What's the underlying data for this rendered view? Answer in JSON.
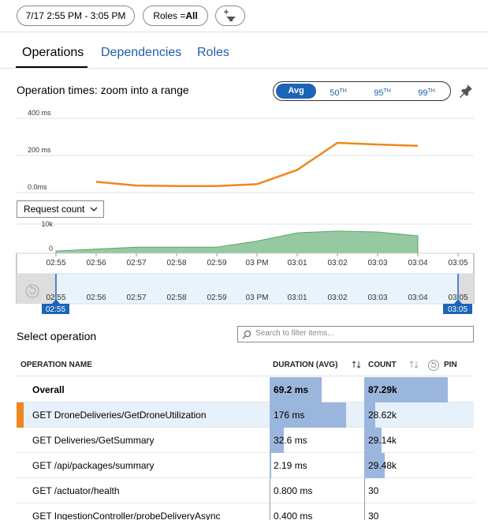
{
  "toolbar": {
    "time_range": "7/17 2:55 PM - 3:05 PM",
    "roles_prefix": "Roles = ",
    "roles_value": "All"
  },
  "tabs": [
    {
      "label": "Operations",
      "active": true
    },
    {
      "label": "Dependencies",
      "active": false
    },
    {
      "label": "Roles",
      "active": false
    }
  ],
  "operation_times": {
    "title": "Operation times: zoom into a range",
    "segments": [
      {
        "main": "Avg",
        "sup": "",
        "active": true
      },
      {
        "main": "50",
        "sup": "TH",
        "active": false
      },
      {
        "main": "95",
        "sup": "TH",
        "active": false
      },
      {
        "main": "99",
        "sup": "TH",
        "active": false
      }
    ],
    "pin_icon": "pin-icon"
  },
  "chart_data": [
    {
      "type": "line",
      "x": [
        "02:55",
        "02:56",
        "02:57",
        "02:58",
        "02:59",
        "03 PM",
        "03:01",
        "03:02",
        "03:03",
        "03:04"
      ],
      "series": [
        {
          "values": [
            null,
            58,
            38,
            35,
            35,
            45,
            122,
            268,
            259,
            252
          ],
          "color": "#f0861f"
        }
      ],
      "ylim": [
        0,
        400
      ],
      "yticks": [
        "400 ms",
        "200 ms",
        "0.0ms"
      ],
      "grid": true
    },
    {
      "type": "area",
      "x": [
        "02:55",
        "02:56",
        "02:57",
        "02:58",
        "02:59",
        "03 PM",
        "03:01",
        "03:02",
        "03:03",
        "03:04"
      ],
      "series": [
        {
          "values": [
            null,
            0.8,
            2.1,
            2.1,
            2.1,
            4.2,
            7.0,
            7.6,
            7.3,
            6.0
          ],
          "color": "#5fa36b"
        }
      ],
      "ylim": [
        0,
        10
      ],
      "yticks": [
        "10k",
        "0"
      ],
      "metric": "Request count"
    }
  ],
  "time_axis": [
    "02:55",
    "02:56",
    "02:57",
    "02:58",
    "02:59",
    "03 PM",
    "03:01",
    "03:02",
    "03:03",
    "03:04",
    "03:05"
  ],
  "brush": {
    "start_label": "02:55",
    "end_label": "03:05"
  },
  "select_operation": {
    "title": "Select operation",
    "search_placeholder": "Search to filter items..."
  },
  "table": {
    "headers": {
      "name": "OPERATION NAME",
      "duration": "DURATION (AVG)",
      "count": "COUNT",
      "pin": "PIN"
    },
    "rows": [
      {
        "name": "Overall",
        "duration": "69.2 ms",
        "count": "87.29k",
        "duration_fill": 0.55,
        "count_fill": 0.76,
        "overall": true,
        "selected": false
      },
      {
        "name": "GET DroneDeliveries/GetDroneUtilization",
        "duration": "176 ms",
        "count": "28.62k",
        "duration_fill": 0.81,
        "count_fill": 0.1,
        "overall": false,
        "selected": true
      },
      {
        "name": "GET Deliveries/GetSummary",
        "duration": "32.6 ms",
        "count": "29.14k",
        "duration_fill": 0.15,
        "count_fill": 0.16,
        "overall": false,
        "selected": false
      },
      {
        "name": "GET /api/packages/summary",
        "duration": "2.19 ms",
        "count": "29.48k",
        "duration_fill": 0.01,
        "count_fill": 0.19,
        "overall": false,
        "selected": false
      },
      {
        "name": "GET /actuator/health",
        "duration": "0.800 ms",
        "count": "30",
        "duration_fill": 0,
        "count_fill": 0,
        "overall": false,
        "selected": false
      },
      {
        "name": "GET IngestionController/probeDeliveryAsync",
        "duration": "0.400 ms",
        "count": "30",
        "duration_fill": 0,
        "count_fill": 0,
        "overall": false,
        "selected": false
      }
    ]
  },
  "colors": {
    "accent": "#1d63b8",
    "line": "#f0861f",
    "area": "#5fa36b",
    "selected_row": "#e6f1fb",
    "bar": "#9bb6dd"
  }
}
